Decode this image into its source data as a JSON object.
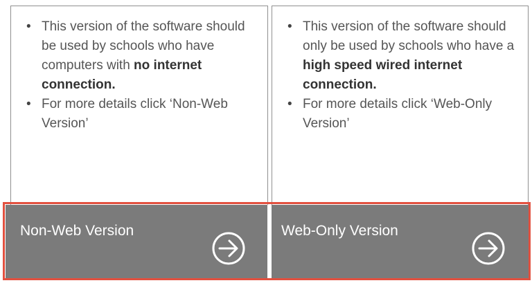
{
  "cards": [
    {
      "bullet1_pre": "This version of the software should be used by schools who have computers with ",
      "bullet1_bold": "no internet connection.",
      "bullet2": "For more details click ‘Non-Web Version’",
      "button_label": "Non-Web Version",
      "button_icon": "arrow-right-circle-icon"
    },
    {
      "bullet1_pre": "This version of the software should only be used by schools who have a ",
      "bullet1_bold": "high speed wired internet connection.",
      "bullet2": "For more details click ‘Web-Only Version’",
      "button_label": "Web-Only Version",
      "button_icon": "arrow-right-circle-icon"
    }
  ],
  "colors": {
    "button_bg": "#7b7b7b",
    "highlight": "#e2503f",
    "text": "#555555"
  }
}
